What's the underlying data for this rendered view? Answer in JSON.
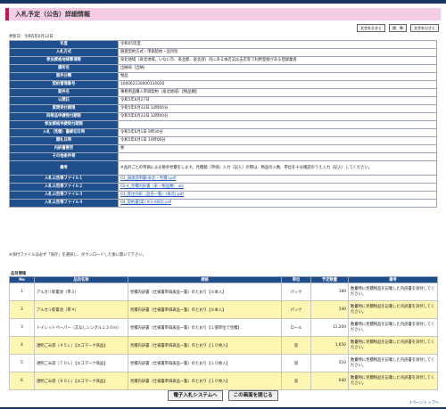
{
  "title": "入札予定（公告）詳細情報",
  "font_buttons": [
    "文字を大きく",
    "標　準",
    "文字を小さく"
  ],
  "updated": "更新日：令和5年6月22日",
  "info_rows": [
    {
      "label": "年度",
      "value": "令和05年度"
    },
    {
      "label": "入札方式",
      "value": "随意契約方式・単価契約・品目別"
    },
    {
      "label": "参加資格地域事項等",
      "value": "泉北地域（泉北地域、いない市、泉北郡、泉北部）内にある本店又は支店等で利用登録がある登録業者"
    },
    {
      "label": "課所名",
      "value": "出納局（出納）"
    },
    {
      "label": "案件分類",
      "value": "物品"
    },
    {
      "label": "契約管理番号",
      "value": "100062230000134026"
    },
    {
      "label": "案件名",
      "value": "事務用品購入単価契約（泉北地域）【物品類】"
    },
    {
      "label": "公開日",
      "value": "令和5年6月27日"
    },
    {
      "label": "質問受付期限",
      "value": "令和5年6月22日 12時00分"
    },
    {
      "label": "同等品申請受付期限",
      "value": "令和5年6月22日 12時00分"
    },
    {
      "label": "参加資格申請受付期限",
      "value": ""
    },
    {
      "label": "入札（見積）書締切日時",
      "value": "令和5年6月1日 9時30分"
    },
    {
      "label": "開札日時",
      "value": "令和5年6月1日 10時00分"
    },
    {
      "label": "内訳書要否",
      "value": "要"
    },
    {
      "label": "その他条件等",
      "value": ""
    },
    {
      "label": "備考",
      "value": "※品目ごとの単価による競争見積をします。見積額（単価）入力（記入）の際は、物品の入数、単位を十分確認のうえ入力（記入）してください。"
    }
  ],
  "attachments": [
    {
      "label": "入札公告等ファイル１",
      "file": "01_調達説明書(泉北・見積).pdf"
    },
    {
      "label": "入札公告等ファイル２",
      "file": "02-4_見積内訳書（泉・物品類）.xls"
    },
    {
      "label": "入札公告等ファイル３",
      "file": "03_発注内訳（品名一覧）(泉北).pdf"
    },
    {
      "label": "入札公告等ファイル４",
      "file": "04_契約書(案) ※3-4泉北.pdf"
    }
  ],
  "note": "※添付ファイルは必ず「保存」を選択し、ダウンロードした後に開いて下さい。",
  "items_title": "品目情報",
  "items_headers": [
    "No",
    "品目名称",
    "規格",
    "単位",
    "予定数量",
    "備考"
  ],
  "items": [
    {
      "no": "1",
      "name": "アルカリ乾電池（単３）",
      "spec": "見積内訳書（仕様書単価表品一覧）のとおり【８本入】",
      "unit": "パック",
      "qty": "180",
      "remark": "数量特に見積物品を記載した内訳書を添付してください。"
    },
    {
      "no": "2",
      "name": "アルカリ乾電池（単４）",
      "spec": "見積内訳書（仕様書単価表品一覧）のとおり【８本入】",
      "unit": "パック",
      "qty": "140",
      "remark": "数量特に見積物品を記載した内訳書を添付してください。"
    },
    {
      "no": "3",
      "name": "トイレットペーパー（芯なしシングル１３０ｍ）",
      "spec": "見積内訳書（仕様書単価表品一覧）のとおり【１個単位で見積】",
      "unit": "ロール",
      "qty": "11,200",
      "remark": "数量特に見積物品を記載した内訳書を添付してください。"
    },
    {
      "no": "4",
      "name": "透明ごみ袋（４５Ｌ）【エコマーク商品】",
      "spec": "見積内訳書（仕様書単価表品一覧）のとおり【１０枚入】",
      "unit": "袋",
      "qty": "1,650",
      "remark": "数量特に見積物品を記載した内訳書を添付してください。"
    },
    {
      "no": "5",
      "name": "透明ごみ袋（７０Ｌ）【エコマーク商品】",
      "spec": "見積内訳書（仕様書単価表品一覧）のとおり【１０枚入】",
      "unit": "袋",
      "qty": "510",
      "remark": "数量特に見積物品を記載した内訳書を添付してください。"
    },
    {
      "no": "6",
      "name": "透明ごみ袋（９０Ｌ）【エコマーク商品】",
      "spec": "見積内訳書（仕様書単価表品一覧）のとおり【１０枚入】",
      "unit": "袋",
      "qty": "640",
      "remark": "数量特に見積物品を記載した内訳書を添付してください。"
    }
  ],
  "buttons": {
    "system": "電子入札システムへ",
    "close": "この画面を閉じる"
  },
  "page_top": "↑ページトップへ",
  "colors": {
    "header_navy": "#1e4f8c",
    "title_pink": "#f6cbe4",
    "title_accent": "#c2185b",
    "highlight_yellow": "#fff6b3"
  }
}
